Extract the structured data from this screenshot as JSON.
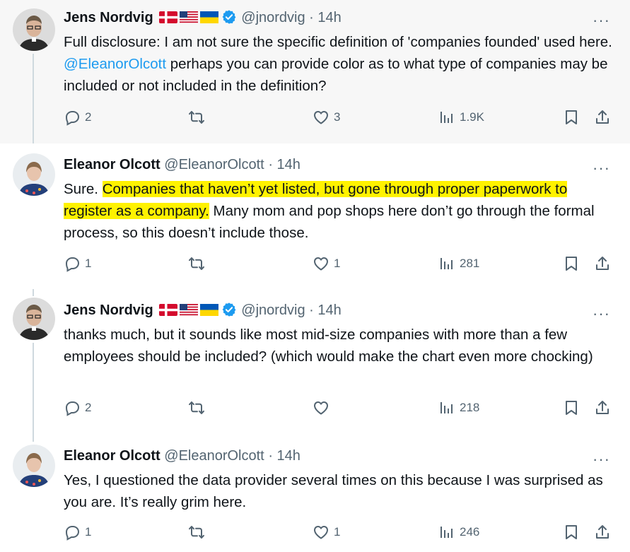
{
  "tweets": [
    {
      "author": "Jens Nordvig",
      "handle": "@jnordvig",
      "time": "14h",
      "flags": [
        "denmark-flag",
        "usa-flag",
        "ukraine-flag"
      ],
      "verified": true,
      "text_parts": {
        "a": "Full disclosure: I am not sure the specific definition of 'companies founded' used here. ",
        "mention": "@EleanorOlcott",
        "b": " perhaps you can provide color as to what type of companies may be included or not included in the definition?"
      },
      "replies": "2",
      "retweets": "",
      "likes": "3",
      "views": "1.9K"
    },
    {
      "author": "Eleanor Olcott",
      "handle": "@EleanorOlcott",
      "time": "14h",
      "text_parts": {
        "a": "Sure. ",
        "highlight": "Companies that haven’t yet listed, but gone through proper paperwork to register as a company.",
        "b": " Many mom and pop shops here don’t go through the formal process, so this doesn’t include those."
      },
      "replies": "1",
      "retweets": "",
      "likes": "1",
      "views": "281"
    },
    {
      "author": "Jens Nordvig",
      "handle": "@jnordvig",
      "time": "14h",
      "flags": [
        "denmark-flag",
        "usa-flag",
        "ukraine-flag"
      ],
      "verified": true,
      "text": "thanks much, but it sounds like most mid-size companies with more than a few employees should be included? (which would make the chart even more chocking)",
      "replies": "2",
      "retweets": "",
      "likes": "",
      "views": "218"
    },
    {
      "author": "Eleanor Olcott",
      "handle": "@EleanorOlcott",
      "time": "14h",
      "text": "Yes, I questioned the data provider several times on this because I was surprised as you are. It’s really grim here.",
      "replies": "1",
      "retweets": "",
      "likes": "1",
      "views": "246"
    }
  ],
  "ui": {
    "separator": "·",
    "more_label": "···"
  },
  "colors": {
    "accent": "#1d9bf0",
    "muted": "#536471",
    "highlight": "#fff200"
  }
}
